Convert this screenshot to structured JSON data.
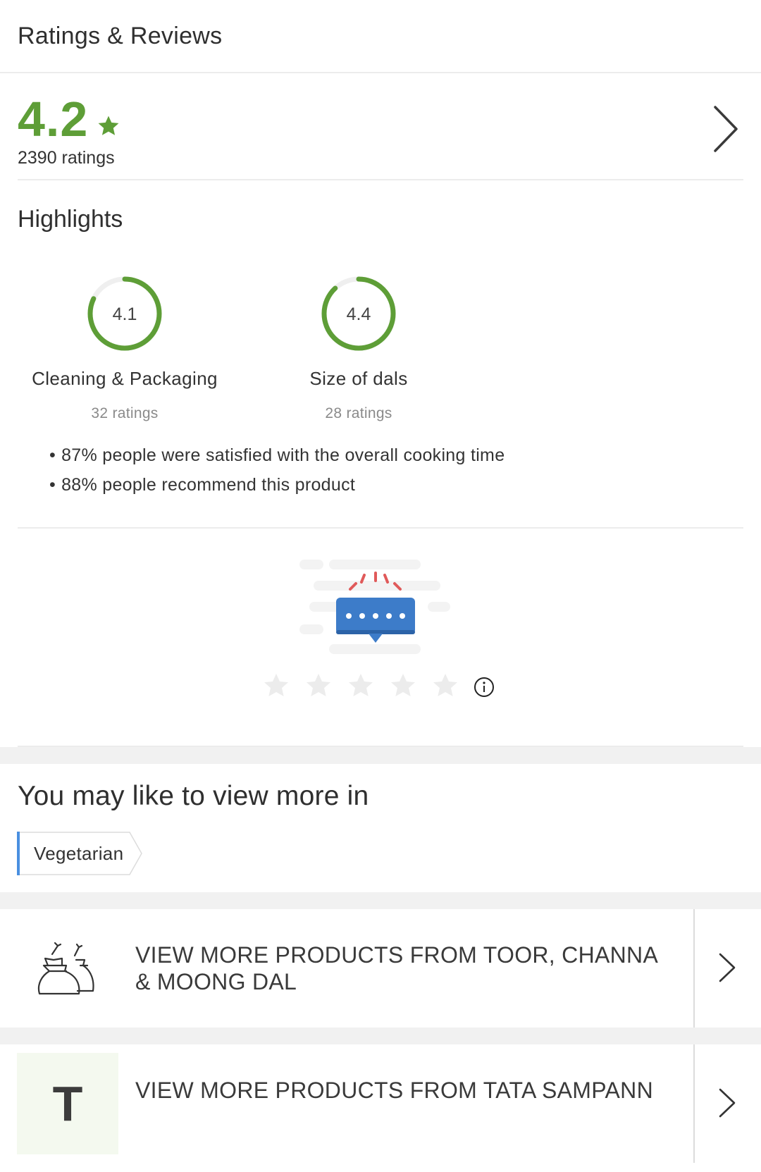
{
  "header": {
    "title": "Ratings & Reviews"
  },
  "summary": {
    "rating": "4.2",
    "count_text": "2390 ratings",
    "accent": "#5e9e37"
  },
  "highlights": {
    "title": "Highlights",
    "items": [
      {
        "value": "4.1",
        "label": "Cleaning & Packaging",
        "count_text": "32 ratings",
        "score": 4.1
      },
      {
        "value": "4.4",
        "label": "Size of dals",
        "count_text": "28 ratings",
        "score": 4.4
      }
    ],
    "bullets": [
      "87% people were satisfied with the overall cooking time",
      "88% people recommend this product"
    ]
  },
  "rate_prompt": {
    "stars": 5,
    "info_icon": "info-icon"
  },
  "view_more": {
    "title": "You may like to view more in",
    "tags": [
      "Vegetarian"
    ]
  },
  "links": [
    {
      "text": "VIEW MORE PRODUCTS FROM TOOR, CHANNA & MOONG DAL",
      "thumb_icon": "grain-sacks-icon"
    },
    {
      "text": "VIEW MORE PRODUCTS FROM TATA SAMPANN",
      "thumb_letter": "T"
    }
  ]
}
